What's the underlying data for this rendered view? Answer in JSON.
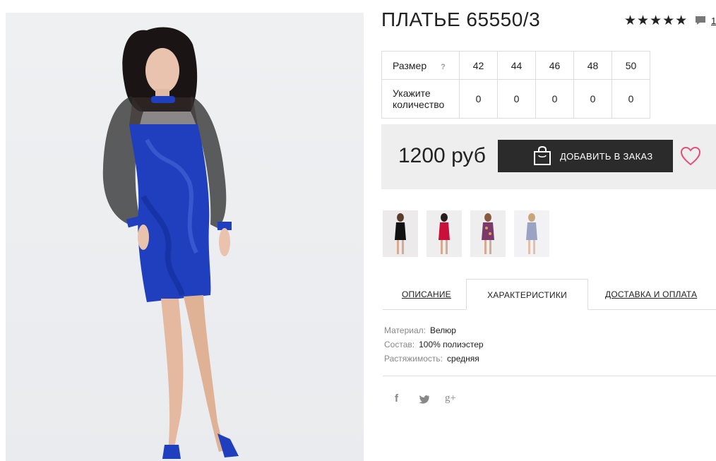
{
  "product": {
    "title": "ПЛАТЬЕ 65550/3",
    "rating_stars": "★★★★★",
    "comment_count": "1",
    "comment_icon": "speech-bubble-icon"
  },
  "sizes": {
    "size_label": "Размер",
    "help_mark": "?",
    "qty_label_line1": "Укажите",
    "qty_label_line2": "количество",
    "columns": [
      "42",
      "44",
      "46",
      "48",
      "50"
    ],
    "quantities": [
      "0",
      "0",
      "0",
      "0",
      "0"
    ]
  },
  "purchase": {
    "price": "1200 руб",
    "add_button_label": "ДОБАВИТЬ В ЗАКАЗ",
    "bag_icon": "shopping-bag-icon",
    "wishlist_icon": "heart-icon"
  },
  "tabs": {
    "description": "ОПИСАНИЕ",
    "characteristics": "ХАРАКТЕРИСТИКИ",
    "delivery": "ДОСТАВКА И ОПЛАТА",
    "active": "characteristics"
  },
  "characteristics": [
    {
      "key": "Материал:",
      "value": "Велюр"
    },
    {
      "key": "Состав:",
      "value": "100% полиэстер"
    },
    {
      "key": "Растяжимость:",
      "value": "средняя"
    }
  ],
  "social": {
    "facebook": "f",
    "twitter": "t",
    "google": "g+"
  },
  "colors": {
    "dress_blue": "#1f3fbf",
    "button_dark": "#2b2b2b",
    "heart_pink": "#e0527a",
    "price_bg": "#eeeeee"
  }
}
